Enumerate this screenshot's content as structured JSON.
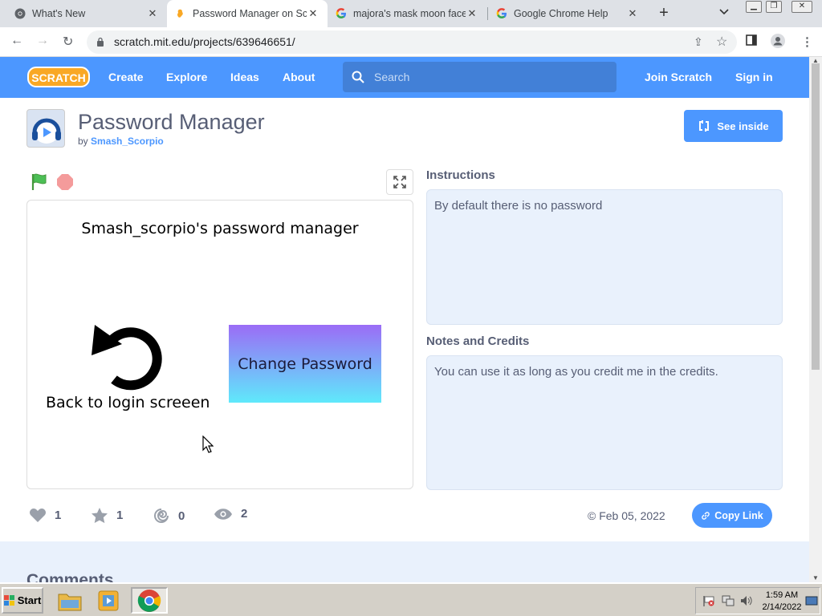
{
  "browser": {
    "tabs": [
      {
        "title": "What's New",
        "favicon": "chrome-icon",
        "active": false
      },
      {
        "title": "Password Manager on Sc",
        "favicon": "scratch-icon",
        "active": true
      },
      {
        "title": "majora's mask moon face",
        "favicon": "google-icon",
        "active": false
      },
      {
        "title": "Google Chrome Help",
        "favicon": "google-icon",
        "active": false
      }
    ],
    "new_tab": "+",
    "tab_list": "⌄",
    "url": "scratch.mit.edu/projects/639646651/"
  },
  "scratch_header": {
    "logo_text": "SCRATCH",
    "nav": [
      "Create",
      "Explore",
      "Ideas",
      "About"
    ],
    "search_placeholder": "Search",
    "join": "Join Scratch",
    "signin": "Sign in"
  },
  "project": {
    "title": "Password Manager",
    "by_prefix": "by",
    "author": "Smash_Scorpio",
    "see_inside": "See inside",
    "stage": {
      "title_text": "Smash_scorpio's password manager",
      "back_text": "Back to login screeen",
      "change_button": "Change Password"
    },
    "instructions_heading": "Instructions",
    "instructions_text": "By default there is no password",
    "notes_heading": "Notes and Credits",
    "notes_text": "You can use it as long as you credit me in the credits.",
    "stats": {
      "loves": "1",
      "favorites": "1",
      "remixes": "0",
      "views": "2"
    },
    "date": "© Feb 05, 2022",
    "copy_link": "Copy Link",
    "comments_heading": "Comments"
  },
  "taskbar": {
    "start": "Start",
    "time": "1:59 AM",
    "date": "2/14/2022"
  },
  "colors": {
    "scratch_blue": "#4c97ff",
    "text": "#575e75",
    "panel_bg": "#e9f1fc"
  }
}
